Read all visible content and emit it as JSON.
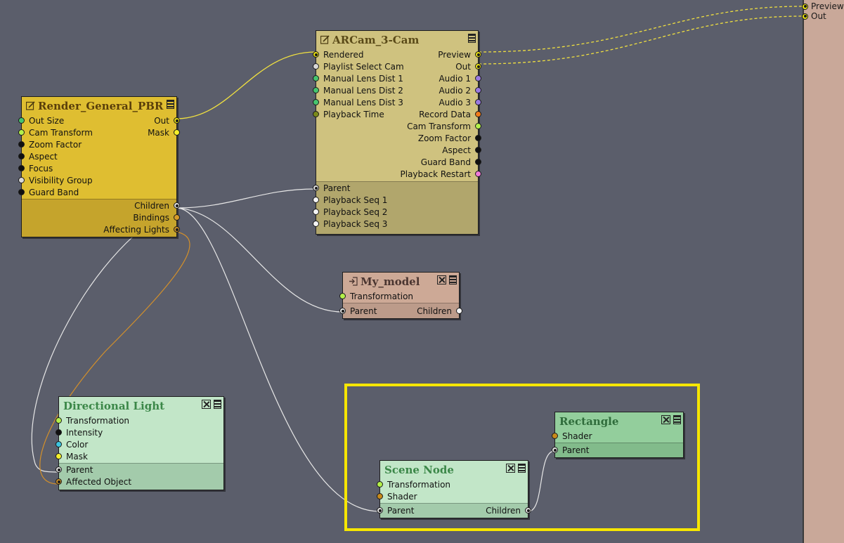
{
  "colors": {
    "canvas": "#5b5e6b",
    "wire_default": "#e8e8e8",
    "wire_yellow": "#f0e040",
    "wire_orange": "#d4902a",
    "highlight": "#f6e600"
  },
  "output_panel": {
    "ports": [
      {
        "label": "Preview",
        "color": "#e8e010"
      },
      {
        "label": "Out",
        "color": "#e8e010"
      }
    ]
  },
  "nodes": {
    "render": {
      "title": "Render_General_PBR",
      "icons": [
        "edit-icon",
        "menu-icon"
      ],
      "inputs": [
        {
          "label": "Out Size",
          "color": "#46c46e"
        },
        {
          "label": "Cam Transform",
          "color": "#b3f04a"
        },
        {
          "label": "Zoom Factor",
          "color": "#101010"
        },
        {
          "label": "Aspect",
          "color": "#101010"
        },
        {
          "label": "Focus",
          "color": "#101010"
        },
        {
          "label": "Visibility Group",
          "color": "#d8d8d8"
        },
        {
          "label": "Guard Band",
          "color": "#101010"
        }
      ],
      "outputs": [
        {
          "label": "Out",
          "color": "#e8e010",
          "ring": true
        },
        {
          "label": "Mask",
          "color": "#f4ef2a"
        }
      ],
      "section_outputs": [
        {
          "label": "Children",
          "color": "#e0e0e0",
          "ring": true
        },
        {
          "label": "Bindings",
          "color": "#d49a2a"
        },
        {
          "label": "Affecting Lights",
          "color": "#c8902a",
          "ring": true
        }
      ]
    },
    "arcam": {
      "title": "ARCam_3-Cam",
      "icons": [
        "edit-icon",
        "menu-icon"
      ],
      "inputs": [
        {
          "label": "Rendered",
          "color": "#e8e010",
          "ring": true
        },
        {
          "label": "Playlist Select Cam",
          "color": "#d8d8d8"
        },
        {
          "label": "Manual Lens Dist 1",
          "color": "#46c46e"
        },
        {
          "label": "Manual Lens Dist 2",
          "color": "#46c46e"
        },
        {
          "label": "Manual Lens Dist 3",
          "color": "#46c46e"
        },
        {
          "label": "Playback Time",
          "color": "#7a8a1a"
        }
      ],
      "outputs": [
        {
          "label": "Preview",
          "color": "#e8e010",
          "ring": true
        },
        {
          "label": "Out",
          "color": "#e8e010",
          "ring": true
        },
        {
          "label": "Audio 1",
          "color": "#9a7ae0"
        },
        {
          "label": "Audio 2",
          "color": "#9a7ae0"
        },
        {
          "label": "Audio 3",
          "color": "#9a7ae0"
        },
        {
          "label": "Record Data",
          "color": "#f07a1a"
        },
        {
          "label": "Cam Transform",
          "color": "#b3f04a"
        },
        {
          "label": "Zoom Factor",
          "color": "#101010"
        },
        {
          "label": "Aspect",
          "color": "#101010"
        },
        {
          "label": "Guard Band",
          "color": "#101010"
        },
        {
          "label": "Playback Restart",
          "color": "#f07ad8"
        }
      ],
      "section_inputs": [
        {
          "label": "Parent",
          "color": "#e0e0e0",
          "ring": true
        },
        {
          "label": "Playback Seq 1",
          "color": "#f4f4f4"
        },
        {
          "label": "Playback Seq 2",
          "color": "#f4f4f4"
        },
        {
          "label": "Playback Seq 3",
          "color": "#f4f4f4"
        }
      ]
    },
    "model": {
      "title": "My_model",
      "icons": [
        "import-icon",
        "close-icon",
        "menu-icon"
      ],
      "inputs": [
        {
          "label": "Transformation",
          "color": "#b3f04a"
        }
      ],
      "section": {
        "input": {
          "label": "Parent",
          "color": "#e0e0e0",
          "ring": true
        },
        "output": {
          "label": "Children",
          "color": "#f4f4f4"
        }
      }
    },
    "light": {
      "title": "Directional Light",
      "icons": [
        "close-icon",
        "menu-icon"
      ],
      "inputs": [
        {
          "label": "Transformation",
          "color": "#b3f04a"
        },
        {
          "label": "Intensity",
          "color": "#101010"
        },
        {
          "label": "Color",
          "color": "#3cc4e0"
        },
        {
          "label": "Mask",
          "color": "#f4ef2a"
        }
      ],
      "section_inputs": [
        {
          "label": "Parent",
          "color": "#e0e0e0",
          "ring": true
        },
        {
          "label": "Affected Object",
          "color": "#c8902a",
          "ring": true
        }
      ]
    },
    "scene": {
      "title": "Scene Node",
      "icons": [
        "close-icon",
        "menu-icon"
      ],
      "inputs": [
        {
          "label": "Transformation",
          "color": "#b3f04a"
        },
        {
          "label": "Shader",
          "color": "#c88a1a"
        }
      ],
      "section": {
        "input": {
          "label": "Parent",
          "color": "#e0e0e0",
          "ring": true
        },
        "output": {
          "label": "Children",
          "color": "#e0e0e0",
          "ring": true
        }
      }
    },
    "rect": {
      "title": "Rectangle",
      "icons": [
        "close-icon",
        "menu-icon"
      ],
      "inputs": [
        {
          "label": "Shader",
          "color": "#c88a1a"
        }
      ],
      "section_inputs": [
        {
          "label": "Parent",
          "color": "#e0e0e0",
          "ring": true
        }
      ]
    }
  }
}
